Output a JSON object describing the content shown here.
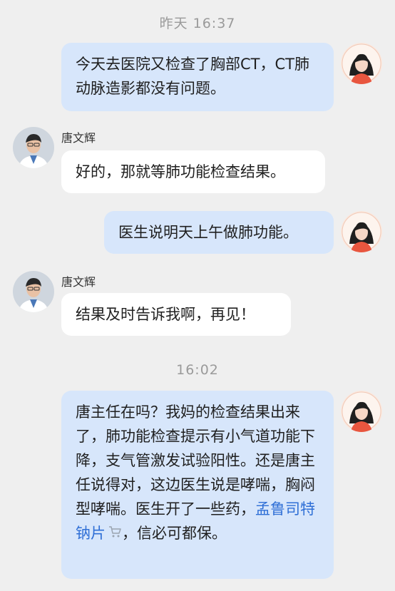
{
  "timestamps": {
    "first": "昨天  16:37",
    "second": "16:02"
  },
  "messages": [
    {
      "sender": "me",
      "text": "今天去医院又检查了胸部CT，CT肺动脉造影都没有问题。"
    },
    {
      "sender": "doctor",
      "name": "唐文辉",
      "text": "好的，那就等肺功能检查结果。"
    },
    {
      "sender": "me",
      "text": "医生说明天上午做肺功能。"
    },
    {
      "sender": "doctor",
      "name": "唐文辉",
      "text": "结果及时告诉我啊，再见！"
    },
    {
      "sender": "me",
      "text_before": "唐主任在吗？我妈的检查结果出来了，肺功能检查提示有小气道功能下降，支气管激发试验阳性。还是唐主任说得对，这边医生说是哮喘，胸闷型哮喘。医生开了一些药，",
      "link": "孟鲁司特钠片",
      "text_after": "，信必可都保。"
    }
  ],
  "colors": {
    "background": "#efefef",
    "my_bubble": "#d7e6fb",
    "doctor_bubble": "#ffffff",
    "link": "#2f6fd6"
  },
  "icons": {
    "user_avatar": "female-avatar-icon",
    "doctor_avatar": "doctor-avatar",
    "cart": "shopping-cart-icon"
  }
}
